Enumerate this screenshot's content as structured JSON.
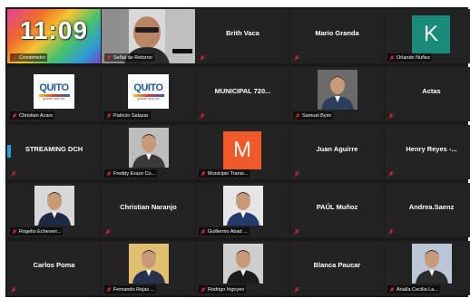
{
  "meeting": {
    "clock": "11:09",
    "tiles": [
      {
        "type": "clock",
        "label": "Cronómetro",
        "speaker": true
      },
      {
        "type": "camera",
        "label": "Señal de Retorno"
      },
      {
        "type": "name",
        "name": "Brith Vaca"
      },
      {
        "type": "name",
        "name": "Mario Granda"
      },
      {
        "type": "avatar",
        "letter": "K",
        "avatar_color": "#1a8a7a",
        "label": "Orlando Nuñez"
      },
      {
        "type": "logo",
        "logo": "QUITO",
        "logo_sub": "grande otra vez",
        "label": "Christian Acaro"
      },
      {
        "type": "logo",
        "logo": "QUITO",
        "logo_sub": "grande otra vez",
        "label": "Patricio Salazar"
      },
      {
        "type": "name",
        "name": "MUNICIPAL 720..."
      },
      {
        "type": "person",
        "label": "Samuel Bysn",
        "shirt": "#2c3e5a",
        "bg": "#6b6b6b"
      },
      {
        "type": "name",
        "name": "Actas"
      },
      {
        "type": "name",
        "name": "STREAMING DCH",
        "stub": true
      },
      {
        "type": "person",
        "label": "Freddy Erazo Co...",
        "shirt": "#3a3a3a",
        "bg": "#bdbdbd"
      },
      {
        "type": "avatar",
        "letter": "M",
        "avatar_color": "#f05a28",
        "label": "Municipio Transi..."
      },
      {
        "type": "name",
        "name": "Juan Aguirre"
      },
      {
        "type": "name",
        "name": "Henry Reyes -..."
      },
      {
        "type": "person",
        "label": "Rogelio Echeverr...",
        "shirt": "#1d2a44",
        "bg": "#d8d8d8"
      },
      {
        "type": "name",
        "name": "Christian Naranjo"
      },
      {
        "type": "person",
        "label": "Guillermo Abad ...",
        "shirt": "#233a6a",
        "bg": "#e6e6e6"
      },
      {
        "type": "name",
        "name": "PAÚL Muñoz"
      },
      {
        "type": "name",
        "name": "Andrea.Saenz"
      },
      {
        "type": "name",
        "name": "Carlos Poma"
      },
      {
        "type": "person",
        "label": "Fernando Rojas ...",
        "shirt": "#27324c",
        "bg": "#e0c070"
      },
      {
        "type": "person",
        "label": "Rodrigo Irigoyen",
        "shirt": "#1c1c1c",
        "bg": "#cfcfcf"
      },
      {
        "type": "name",
        "name": "Blanca Paucar"
      },
      {
        "type": "person",
        "label": "Analía Cecilia La...",
        "shirt": "#2b2b2b",
        "bg": "#b9c7d8"
      }
    ]
  },
  "colors": {
    "muted_mic": "#e0252c",
    "tile_bg": "#232323",
    "grid_bg": "#1a1a1a"
  }
}
